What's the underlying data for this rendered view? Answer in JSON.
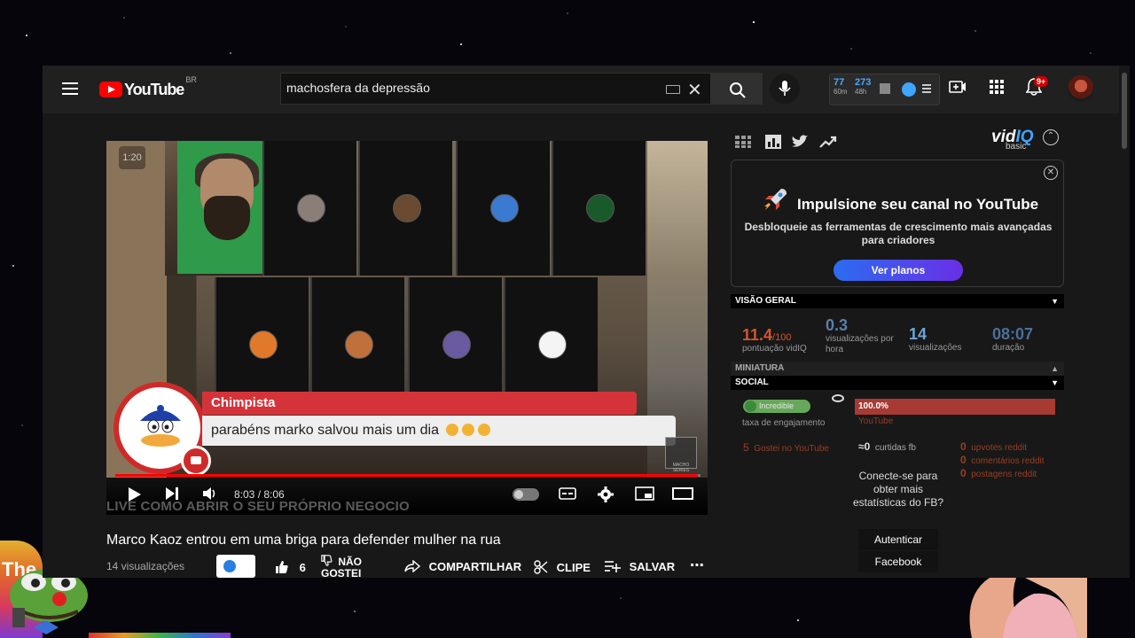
{
  "masthead": {
    "logo_text": "YouTube",
    "country_code": "BR",
    "search_value": "machosfera da depressão",
    "clear_symbol": "✕",
    "stats": {
      "a_value": "77",
      "a_label": "60m",
      "b_value": "273",
      "b_label": "48h"
    },
    "notification_count": "9+",
    "icons": [
      "menu-icon",
      "keyboard-icon",
      "clear-icon",
      "search-icon",
      "mic-icon",
      "create-icon",
      "apps-icon",
      "bell-icon"
    ]
  },
  "player": {
    "timer_badge": "1:20",
    "chat": {
      "name": "Chimpista",
      "message": "parabéns marko salvou mais um dia"
    },
    "watermark": "MACHO SÉRIES",
    "time": "8:03 / 8:06",
    "progress_fraction": 0.996,
    "overlay_text": "LIVE COMO ABRIR O SEU PRÓPRIO NEGOCIO"
  },
  "video": {
    "title": "Marco Kaoz entrou em uma briga para defender mulher na rua",
    "views": "14 visualizações",
    "likes": "6",
    "dislike_label": "NÃO GOSTEI",
    "share_label": "COMPARTILHAR",
    "clip_label": "CLIPE",
    "save_label": "SALVAR",
    "more_label": "⋯"
  },
  "vidiq": {
    "logo_prefix": "vid",
    "logo_suffix": "IQ",
    "plan": "basic",
    "promo": {
      "title": "Impulsione seu canal no YouTube",
      "subtitle": "Desbloqueie as ferramentas de crescimento mais avançadas para criadores",
      "button": "Ver planos"
    },
    "sections": {
      "overview": "VISÃO GERAL",
      "thumbnail": "MINIATURA",
      "social": "SOCIAL"
    },
    "overview": {
      "score": "11.4",
      "score_max": "/100",
      "score_label": "pontuação vidIQ",
      "vph": "0.3",
      "vph_label": "visualizações por hora",
      "views": "14",
      "views_label": "visualizações",
      "duration": "08:07",
      "duration_label": "duração"
    },
    "social": {
      "engagement_badge": "Incredible",
      "engagement_label": "taxa de engajamento",
      "yt_percent": "100.0%",
      "yt_label": "YouTube",
      "likes_count": "5",
      "likes_label": "Gostei no YouTube",
      "fb_count": "≈0",
      "fb_label": "curtidas fb",
      "reddit_upvotes": "0",
      "reddit_upvotes_label": "upvotes reddit",
      "reddit_comments": "0",
      "reddit_comments_label": "comentários reddit",
      "reddit_posts": "0",
      "reddit_posts_label": "postagens reddit",
      "connect_text": "Conecte-se para obter mais estatísticas do FB?",
      "auth_button": "Autenticar",
      "facebook_button": "Facebook"
    }
  },
  "overlay": {
    "corner_text": "The"
  },
  "colors": {
    "accent_red": "#ff0000",
    "vidiq_blue": "#3ea6ff",
    "score_orange": "#d4562a"
  }
}
